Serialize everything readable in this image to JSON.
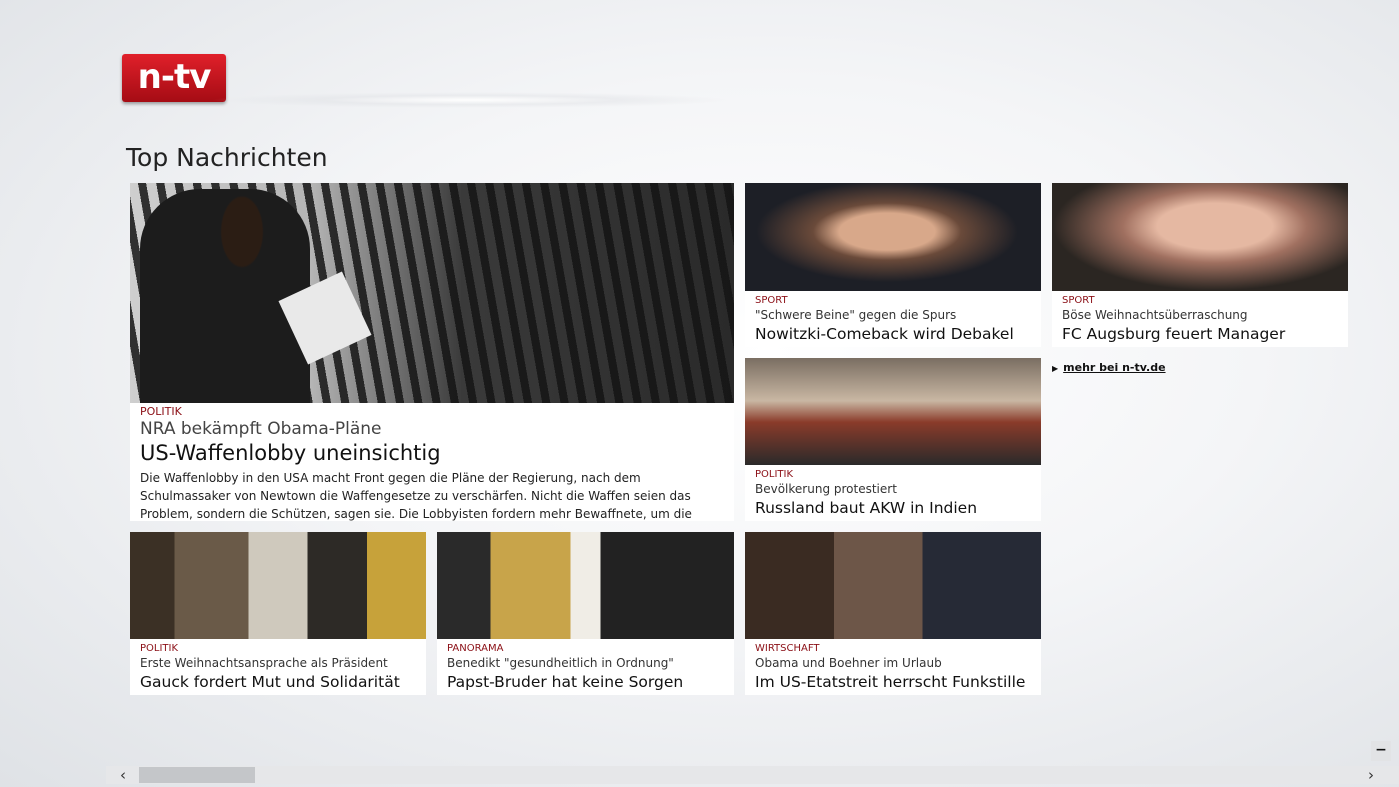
{
  "logo": {
    "text": "n-tv"
  },
  "section_title": "Top Nachrichten",
  "featured": {
    "category": "POLITIK",
    "subtitle": "NRA bekämpft Obama-Pläne",
    "headline": "US-Waffenlobby uneinsichtig",
    "body": "Die Waffenlobby in den USA macht Front gegen die Pläne der Regierung, nach dem Schulmassaker von Newtown die Waffengesetze zu verschärfen. Nicht die Waffen seien das Problem, sondern die Schützen, sagen sie. Die Lobbyisten fordern mehr Bewaffnete, um die \"bösen Typen\" in Schach zu..."
  },
  "tiles": [
    {
      "category": "SPORT",
      "subtitle": "\"Schwere Beine\" gegen die Spurs",
      "headline": "Nowitzki-Comeback wird Debakel"
    },
    {
      "category": "SPORT",
      "subtitle": "Böse Weihnachtsüberraschung",
      "headline": "FC Augsburg feuert Manager"
    },
    {
      "category": "POLITIK",
      "subtitle": "Bevölkerung protestiert",
      "headline": "Russland baut AKW in Indien"
    },
    {
      "category": "POLITIK",
      "subtitle": "Erste Weihnachtsansprache als Präsident",
      "headline": "Gauck fordert Mut und Solidarität"
    },
    {
      "category": "PANORAMA",
      "subtitle": "Benedikt \"gesundheitlich in Ordnung\"",
      "headline": "Papst-Bruder hat keine Sorgen"
    },
    {
      "category": "WIRTSCHAFT",
      "subtitle": "Obama und Boehner im Urlaub",
      "headline": "Im US-Etatstreit herrscht Funkstille"
    }
  ],
  "more_link": {
    "arrow": "▶",
    "text": "mehr bei n-tv.de"
  },
  "scrollbar": {
    "left_arrow": "‹",
    "right_arrow": "›"
  },
  "zoom_button": {
    "label": "−"
  },
  "colors": {
    "category": "#8b0f16",
    "logo_red": "#c8101a"
  }
}
